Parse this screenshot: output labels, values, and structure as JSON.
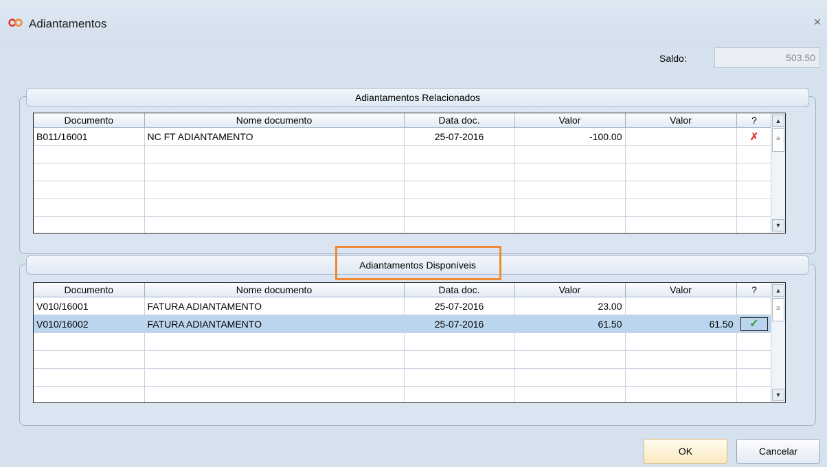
{
  "window": {
    "title": "Adiantamentos",
    "close_glyph": "✕"
  },
  "saldo": {
    "label": "Saldo:",
    "value": "503.50"
  },
  "related": {
    "header": "Adiantamentos Relacionados",
    "columns": [
      "Documento",
      "Nome documento",
      "Data doc.",
      "Valor",
      "Valor",
      "?"
    ],
    "rows": [
      {
        "documento": "B011/16001",
        "nome": "NC FT ADIANTAMENTO",
        "data": "25-07-2016",
        "valor": "-100.00",
        "valor2": "",
        "status": "remove-icon"
      }
    ]
  },
  "available": {
    "header": "Adiantamentos Disponíveis",
    "columns": [
      "Documento",
      "Nome documento",
      "Data doc.",
      "Valor",
      "Valor",
      "?"
    ],
    "rows": [
      {
        "documento": "V010/16001",
        "nome": "FATURA ADIANTAMENTO",
        "data": "25-07-2016",
        "valor": "23.00",
        "valor2": "",
        "status": ""
      },
      {
        "documento": "V010/16002",
        "nome": "FATURA ADIANTAMENTO",
        "data": "25-07-2016",
        "valor": "61.50",
        "valor2": "61.50",
        "status": "check-icon"
      }
    ]
  },
  "buttons": {
    "ok": "OK",
    "cancel": "Cancelar"
  },
  "colors": {
    "highlight": "#f08a30",
    "selected_row": "#bcd5ee",
    "remove": "#e0392f",
    "check": "#2b9a2b"
  }
}
